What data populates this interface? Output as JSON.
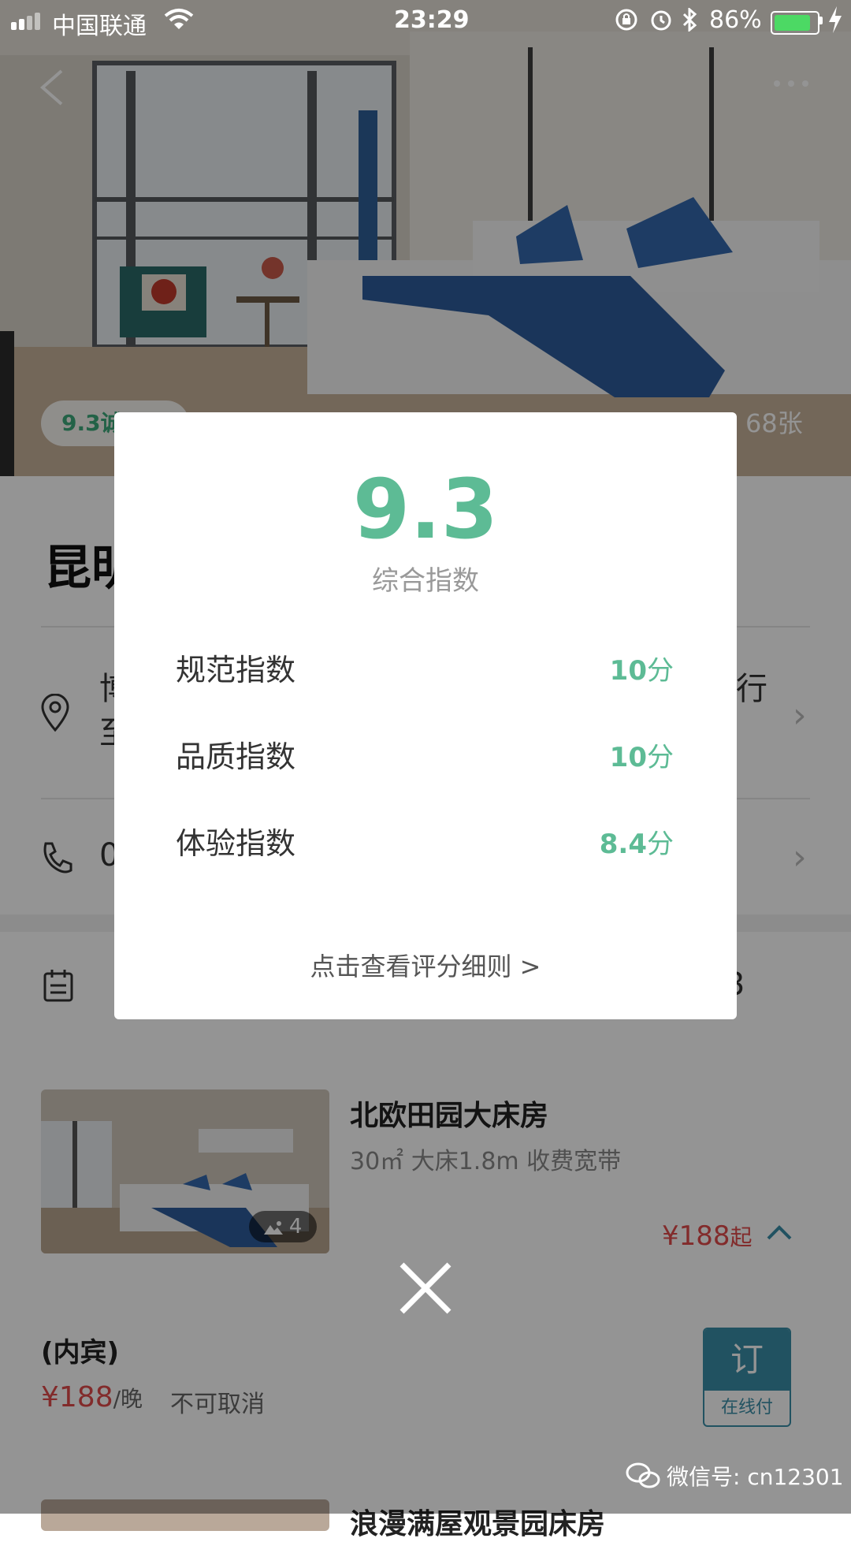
{
  "status_bar": {
    "carrier": "中国联通",
    "time": "23:29",
    "battery_percent": "86%",
    "battery_level": 0.86,
    "battery_color": "#4cd964"
  },
  "hero": {
    "score_pill": "9.3诚",
    "photo_count": "68张"
  },
  "hotel": {
    "title": "昆明",
    "address_line1": "博",
    "address_line2": "至",
    "address_tail": "行",
    "phone_partial": "0",
    "date_tail": "3"
  },
  "room": {
    "name": "北欧田园大床房",
    "spec": "30㎡ 大床1.8m 收费宽带",
    "image_count": "4",
    "price": "¥188",
    "price_suffix": "起"
  },
  "plan": {
    "name": "(内宾)",
    "price": "¥188",
    "per": "/晚",
    "cancel_policy": "不可取消",
    "book_label": "订",
    "book_sub": "在线付"
  },
  "next_room": {
    "name_partial": "浪漫满屋观景园床房"
  },
  "watermark": "微信号: cn12301",
  "modal": {
    "score": "9.3",
    "score_label": "综合指数",
    "rows": [
      {
        "label": "规范指数",
        "value": "10",
        "unit": "分"
      },
      {
        "label": "品质指数",
        "value": "10",
        "unit": "分"
      },
      {
        "label": "体验指数",
        "value": "8.4",
        "unit": "分"
      }
    ],
    "link": "点击查看评分细则 >"
  },
  "colors": {
    "accent_green": "#5dbb95",
    "price_red": "#e04b4b",
    "book_blue": "#3a8ea8"
  }
}
